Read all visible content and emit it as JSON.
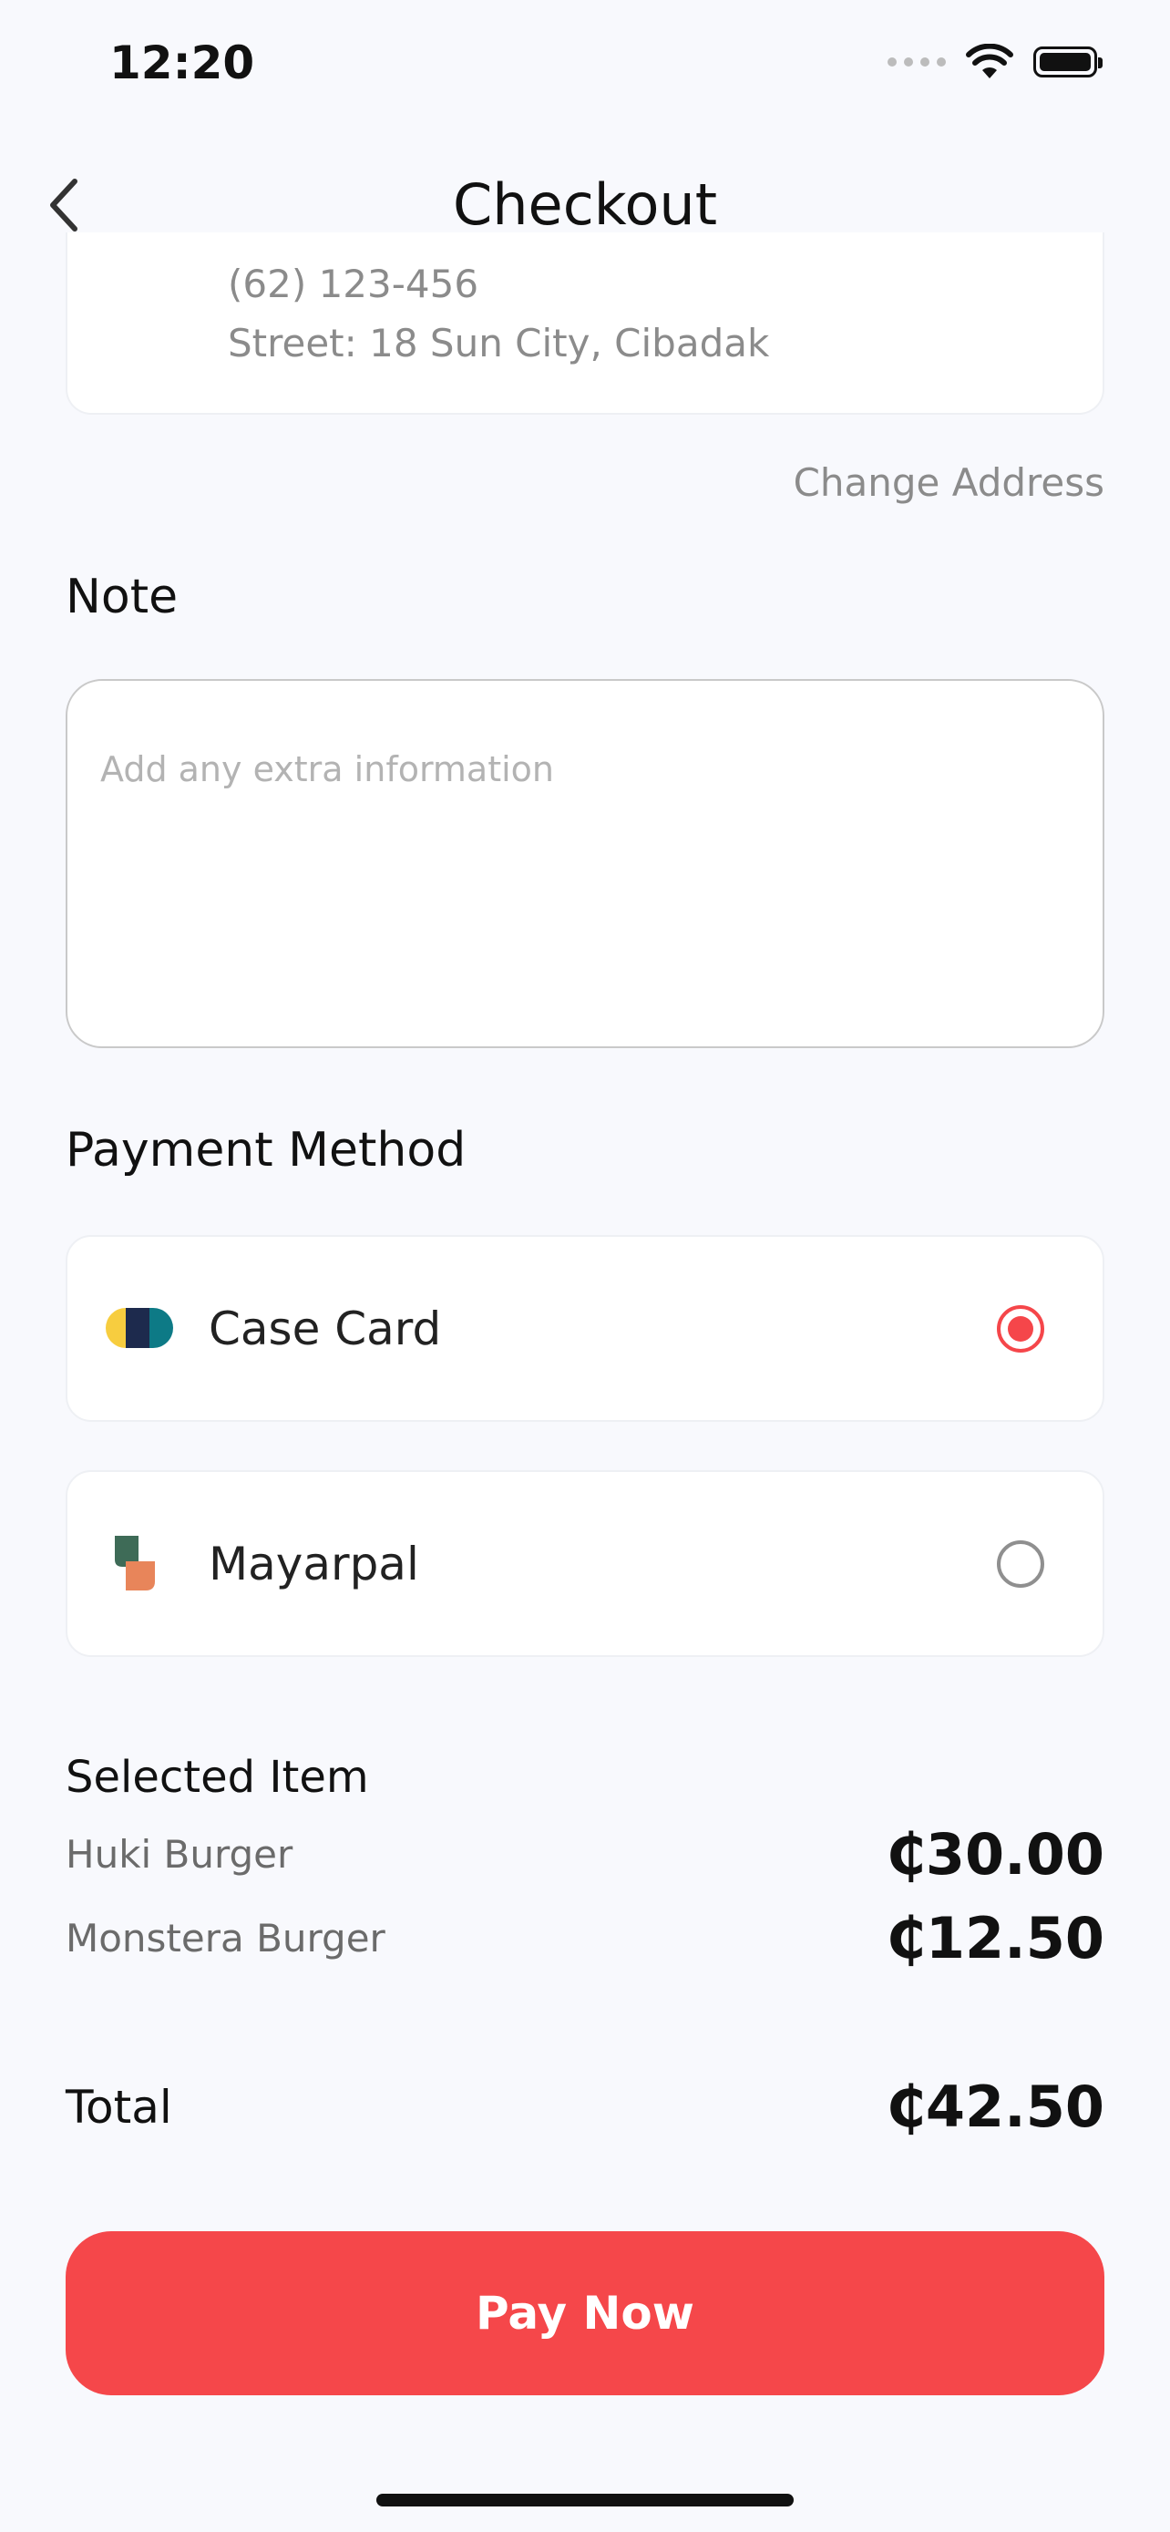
{
  "status_bar": {
    "time": "12:20"
  },
  "header": {
    "title": "Checkout"
  },
  "address": {
    "phone": "(62) 123-456",
    "street": "Street: 18 Sun City, Cibadak",
    "change_label": "Change Address"
  },
  "note": {
    "label": "Note",
    "placeholder": "Add any extra information",
    "value": ""
  },
  "payment": {
    "label": "Payment Method",
    "options": [
      {
        "label": "Case Card",
        "icon": "case-card-logo-icon",
        "selected": true
      },
      {
        "label": "Mayarpal",
        "icon": "mayarpal-logo-icon",
        "selected": false
      }
    ]
  },
  "selected_items": {
    "label": "Selected Item",
    "items": [
      {
        "name": "Huki Burger",
        "price": "₵30.00"
      },
      {
        "name": "Monstera Burger",
        "price": "₵12.50"
      }
    ]
  },
  "total": {
    "label": "Total",
    "value": "₵42.50"
  },
  "pay_button": {
    "label": "Pay Now"
  },
  "colors": {
    "accent": "#f5474a",
    "background": "#f8f9fd"
  }
}
